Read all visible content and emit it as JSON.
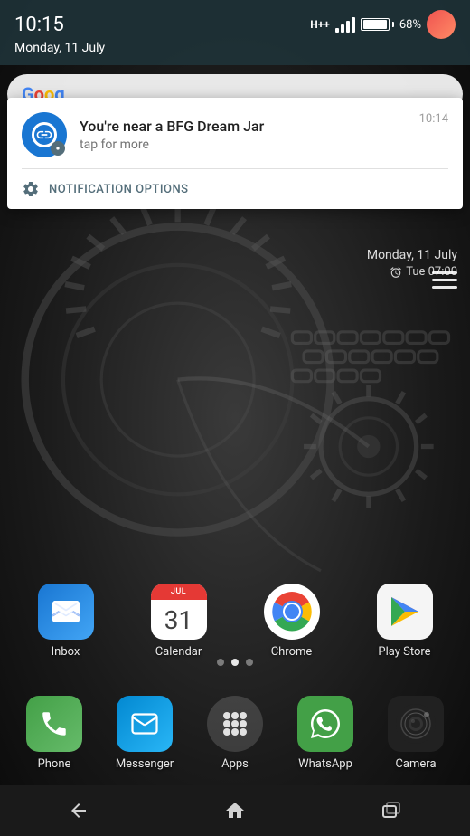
{
  "statusBar": {
    "time": "10:15",
    "date": "Monday, 11 July",
    "battery": "68%",
    "signal": "H++"
  },
  "notification": {
    "title": "You're near a BFG Dream Jar",
    "subtitle": "tap for more",
    "time": "10:14",
    "options_label": "NOTIFICATION OPTIONS"
  },
  "homeOverlay": {
    "date": "Monday, 11 July",
    "alarm": "Tue 07:00"
  },
  "apps_row1": [
    {
      "name": "Inbox",
      "type": "inbox"
    },
    {
      "name": "Calendar",
      "type": "calendar",
      "day": "31"
    },
    {
      "name": "Chrome",
      "type": "chrome"
    },
    {
      "name": "Play Store",
      "type": "playstore"
    }
  ],
  "apps_dock": [
    {
      "name": "Phone",
      "type": "phone"
    },
    {
      "name": "Messenger",
      "type": "messenger"
    },
    {
      "name": "Apps",
      "type": "apps"
    },
    {
      "name": "WhatsApp",
      "type": "whatsapp"
    },
    {
      "name": "Camera",
      "type": "camera"
    }
  ],
  "pageDots": [
    false,
    true,
    false
  ],
  "navBar": {
    "back": "◁",
    "home": "⌂",
    "recents": "▭"
  }
}
